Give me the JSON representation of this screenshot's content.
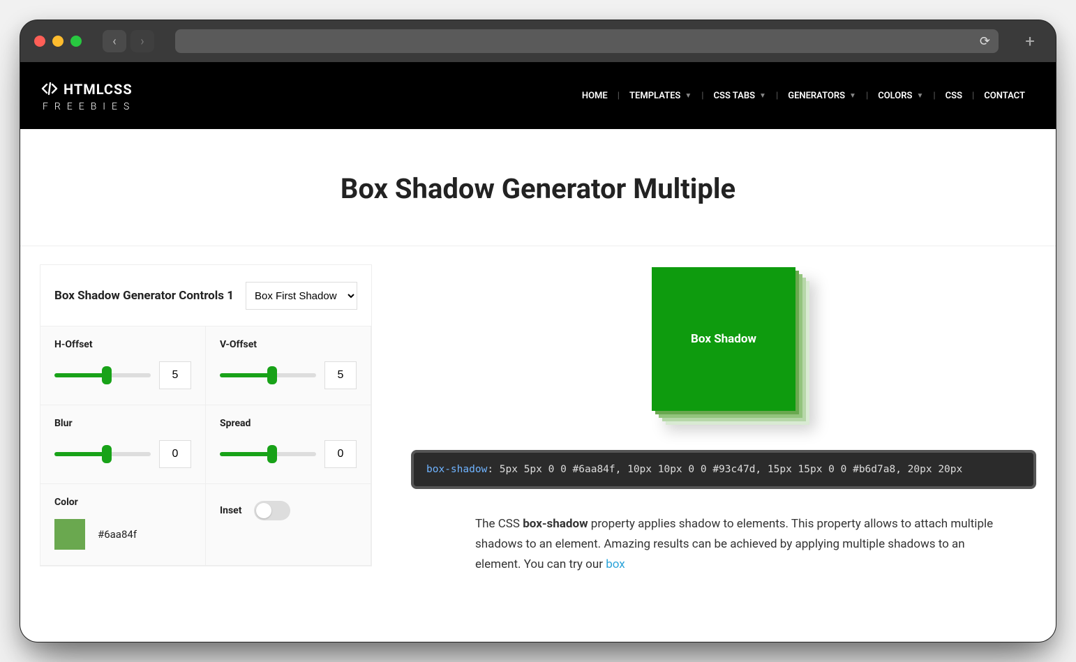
{
  "browser": {
    "back": "‹",
    "forward": "›",
    "reload": "⟳",
    "newtab": "+"
  },
  "site": {
    "logo_top": "HTMLCSS",
    "logo_bottom": "FREEBIES",
    "nav": {
      "home": "HOME",
      "templates": "TEMPLATES",
      "csstabs": "CSS TABS",
      "generators": "GENERATORS",
      "colors": "COLORS",
      "css": "CSS",
      "contact": "CONTACT"
    }
  },
  "page": {
    "title": "Box Shadow Generator Multiple"
  },
  "controls": {
    "title": "Box Shadow Generator Controls 1",
    "select_value": "Box First Shadow",
    "hoffset": {
      "label": "H-Offset",
      "value": "5"
    },
    "voffset": {
      "label": "V-Offset",
      "value": "5"
    },
    "blur": {
      "label": "Blur",
      "value": "0"
    },
    "spread": {
      "label": "Spread",
      "value": "0"
    },
    "color": {
      "label": "Color",
      "value": "#6aa84f"
    },
    "inset": {
      "label": "Inset"
    }
  },
  "preview": {
    "label": "Box Shadow"
  },
  "code": {
    "property": "box-shadow",
    "value": ": 5px 5px 0 0 #6aa84f, 10px 10px 0 0 #93c47d, 15px 15px 0 0 #b6d7a8, 20px 20px"
  },
  "desc": {
    "t1": "The CSS ",
    "bold": "box-shadow",
    "t2": " property applies shadow to elements. This property allows to attach multiple shadows to an element. Amazing results can be achieved by applying multiple shadows to an element. You can try our ",
    "link": "box"
  }
}
